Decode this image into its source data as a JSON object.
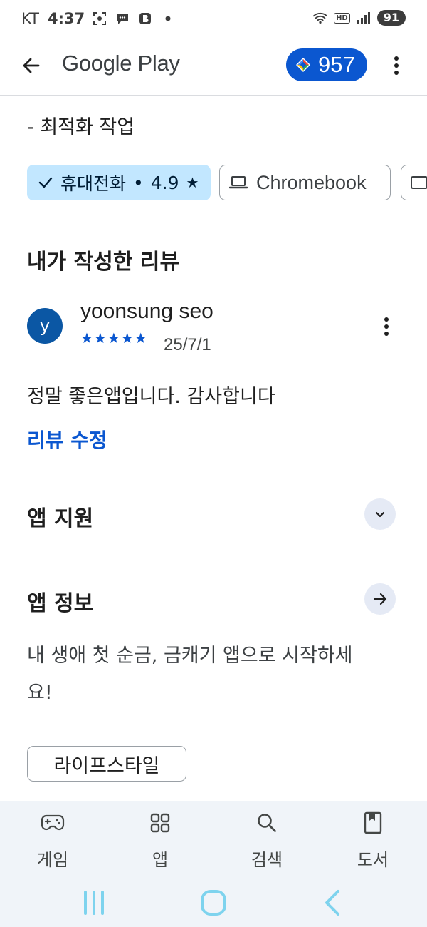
{
  "status_bar": {
    "carrier": "KT",
    "time": "4:37",
    "network_badge": "HD",
    "battery": "91"
  },
  "app_bar": {
    "brand": "Google Play",
    "points": "957"
  },
  "changelog": {
    "item": "- 최적화 작업"
  },
  "device_filters": [
    {
      "label": "휴대전화",
      "rating": "4.9",
      "selected": true
    },
    {
      "label": "Chromebook",
      "selected": false
    }
  ],
  "my_review": {
    "title": "내가 작성한 리뷰",
    "avatar_letter": "y",
    "reviewer": "yoonsung seo",
    "stars": "★★★★★",
    "rating_value": 5,
    "date": "25/7/1",
    "text": "정말 좋은앱입니다. 감사합니다",
    "edit_label": "리뷰 수정"
  },
  "app_support": {
    "title": "앱 지원"
  },
  "app_info": {
    "title": "앱 정보",
    "description": "내 생애 첫 순금, 금캐기 앱으로 시작하세요!",
    "category": "라이프스타일"
  },
  "bottom_nav": [
    {
      "label": "게임",
      "icon": "gamepad-icon"
    },
    {
      "label": "앱",
      "icon": "apps-grid-icon"
    },
    {
      "label": "검색",
      "icon": "search-icon"
    },
    {
      "label": "도서",
      "icon": "book-icon"
    }
  ],
  "colors": {
    "accent": "#0b57d0",
    "chip_selected": "#c2e7ff",
    "nav_background": "#f0f4f9"
  }
}
